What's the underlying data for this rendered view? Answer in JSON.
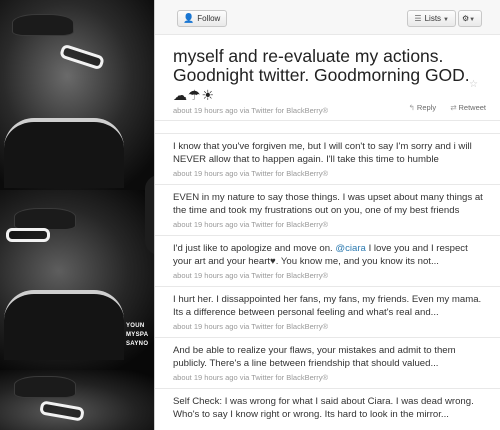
{
  "header": {
    "follow_label": "Follow",
    "lists_label": "Lists"
  },
  "sidebar": {
    "caption_lines": [
      "YOUN",
      "MYSPA",
      "SAYNO"
    ]
  },
  "featured_tweet": {
    "text": "myself and re-evaluate my actions. Goodnight twitter. Goodmorning GOD.",
    "weather_glyphs": "☁☂☀",
    "meta": "about 19 hours ago via Twitter for BlackBerry®",
    "reply_label": "Reply",
    "retweet_label": "Retweet"
  },
  "tweets": [
    {
      "text": "I know that you've forgiven me, but I will con't to say I'm sorry and i will NEVER allow that to happen again. I'll take this time to humble",
      "meta": "about 19 hours ago via Twitter for BlackBerry®"
    },
    {
      "text": "EVEN in my nature to say those things. I was upset about many things at the time and took my frustrations out on you, one of my best friends",
      "meta": "about 19 hours ago via Twitter for BlackBerry®"
    },
    {
      "text_before": "I'd just like to apologize and move on. ",
      "mention": "@ciara",
      "text_after": " I love you and I respect your art and your heart♥. You know me, and you know its not...",
      "meta": "about 19 hours ago via Twitter for BlackBerry®"
    },
    {
      "text": "I hurt her. I dissappointed her fans, my fans, my friends. Even my mama. Its a difference between personal feeling and what's real and...",
      "meta": "about 19 hours ago via Twitter for BlackBerry®"
    },
    {
      "text": "And be able to realize your flaws, your mistakes and admit to them publicly. There's a line between friendship that should valued...",
      "meta": "about 19 hours ago via Twitter for BlackBerry®"
    },
    {
      "text": "Self Check: I was wrong for what I said about Ciara. I was dead wrong. Who's to say I know right or wrong. Its hard to look in the mirror...",
      "meta": ""
    }
  ],
  "icons": {
    "follow": "follow-person-icon",
    "lists": "lists-icon",
    "gear": "gear-icon",
    "star": "favorite-star-icon",
    "reply": "reply-icon",
    "retweet": "retweet-icon"
  },
  "colors": {
    "mention": "#2c7ab0",
    "meta": "#999999",
    "panel_bg": "#ffffff",
    "page_bg": "#000000"
  }
}
